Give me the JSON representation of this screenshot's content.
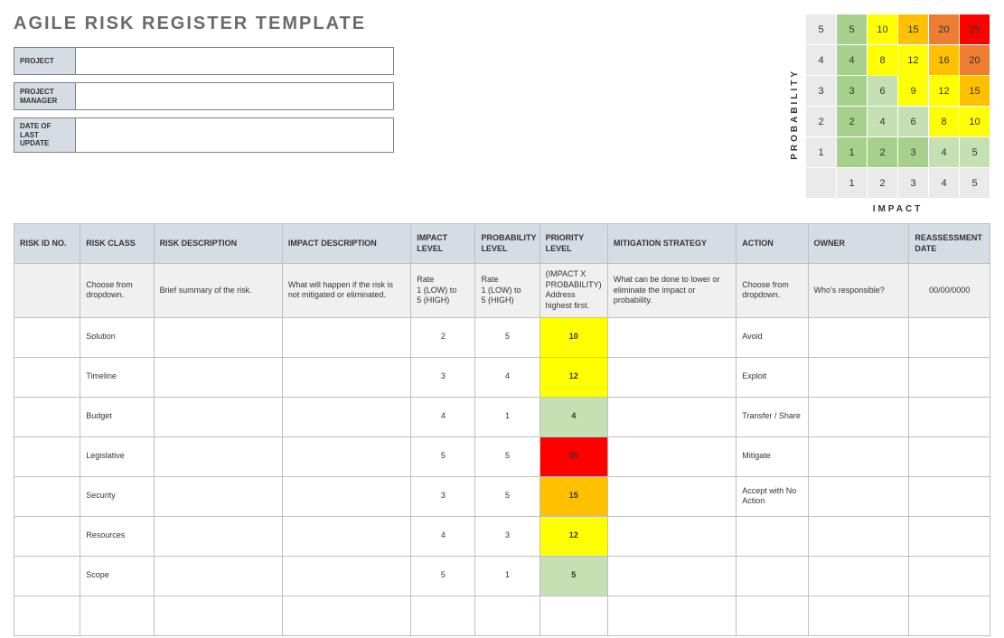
{
  "title": "AGILE RISK REGISTER TEMPLATE",
  "meta": {
    "project_label": "PROJECT",
    "project_value": "",
    "manager_label": "PROJECT MANAGER",
    "manager_value": "",
    "date_label": "DATE OF LAST UPDATE",
    "date_value": ""
  },
  "matrix": {
    "ylabel": "PROBABILITY",
    "xlabel": "IMPACT",
    "row_scales": [
      "5",
      "4",
      "3",
      "2",
      "1"
    ],
    "col_scales": [
      "1",
      "2",
      "3",
      "4",
      "5"
    ],
    "cells": [
      [
        {
          "v": "5",
          "c": "c-green"
        },
        {
          "v": "10",
          "c": "c-yellow"
        },
        {
          "v": "15",
          "c": "c-orange"
        },
        {
          "v": "20",
          "c": "c-dorange"
        },
        {
          "v": "25",
          "c": "c-red"
        }
      ],
      [
        {
          "v": "4",
          "c": "c-green"
        },
        {
          "v": "8",
          "c": "c-yellow"
        },
        {
          "v": "12",
          "c": "c-yellow"
        },
        {
          "v": "16",
          "c": "c-orange"
        },
        {
          "v": "20",
          "c": "c-dorange"
        }
      ],
      [
        {
          "v": "3",
          "c": "c-green"
        },
        {
          "v": "6",
          "c": "c-lime"
        },
        {
          "v": "9",
          "c": "c-yellow"
        },
        {
          "v": "12",
          "c": "c-yellow"
        },
        {
          "v": "15",
          "c": "c-orange"
        }
      ],
      [
        {
          "v": "2",
          "c": "c-green"
        },
        {
          "v": "4",
          "c": "c-lime"
        },
        {
          "v": "6",
          "c": "c-lime"
        },
        {
          "v": "8",
          "c": "c-yellow"
        },
        {
          "v": "10",
          "c": "c-yellow"
        }
      ],
      [
        {
          "v": "1",
          "c": "c-green"
        },
        {
          "v": "2",
          "c": "c-green"
        },
        {
          "v": "3",
          "c": "c-green"
        },
        {
          "v": "4",
          "c": "c-lime"
        },
        {
          "v": "5",
          "c": "c-lime"
        }
      ]
    ]
  },
  "register": {
    "headers": {
      "id": "RISK ID NO.",
      "class": "RISK CLASS",
      "rdesc": "RISK DESCRIPTION",
      "idesc": "IMPACT DESCRIPTION",
      "il": "IMPACT LEVEL",
      "pl": "PROBABILITY LEVEL",
      "pr": "PRIORITY LEVEL",
      "mit": "MITIGATION STRATEGY",
      "act": "ACTION",
      "own": "OWNER",
      "date": "REASSESSMENT DATE"
    },
    "hints": {
      "id": "",
      "class": "Choose from dropdown.",
      "rdesc": "Brief summary of the risk.",
      "idesc": "What will happen if the risk is not mitigated or eliminated.",
      "il": "Rate\n1 (LOW) to\n5 (HIGH)",
      "pl": "Rate\n1 (LOW) to\n5 (HIGH)",
      "pr": "(IMPACT X PROBABILITY)\nAddress highest first.",
      "mit": "What can be done to lower or eliminate the impact or probability.",
      "act": "Choose from dropdown.",
      "own": "Who's responsible?",
      "date": "00/00/0000"
    },
    "rows": [
      {
        "class": "Solution",
        "il": "2",
        "pl": "5",
        "pr": "10",
        "prc": "c-yellow",
        "act": "Avoid"
      },
      {
        "class": "Timeline",
        "il": "3",
        "pl": "4",
        "pr": "12",
        "prc": "c-yellow",
        "act": "Exploit"
      },
      {
        "class": "Budget",
        "il": "4",
        "pl": "1",
        "pr": "4",
        "prc": "c-lime",
        "act": "Transfer / Share"
      },
      {
        "class": "Legislative",
        "il": "5",
        "pl": "5",
        "pr": "25",
        "prc": "c-red",
        "act": "Mitigate"
      },
      {
        "class": "Security",
        "il": "3",
        "pl": "5",
        "pr": "15",
        "prc": "c-orange",
        "act": "Accept with No Action"
      },
      {
        "class": "Resources",
        "il": "4",
        "pl": "3",
        "pr": "12",
        "prc": "c-yellow",
        "act": ""
      },
      {
        "class": "Scope",
        "il": "5",
        "pl": "1",
        "pr": "5",
        "prc": "c-lime",
        "act": ""
      },
      {
        "class": "",
        "il": "",
        "pl": "",
        "pr": "",
        "prc": "",
        "act": ""
      }
    ]
  }
}
